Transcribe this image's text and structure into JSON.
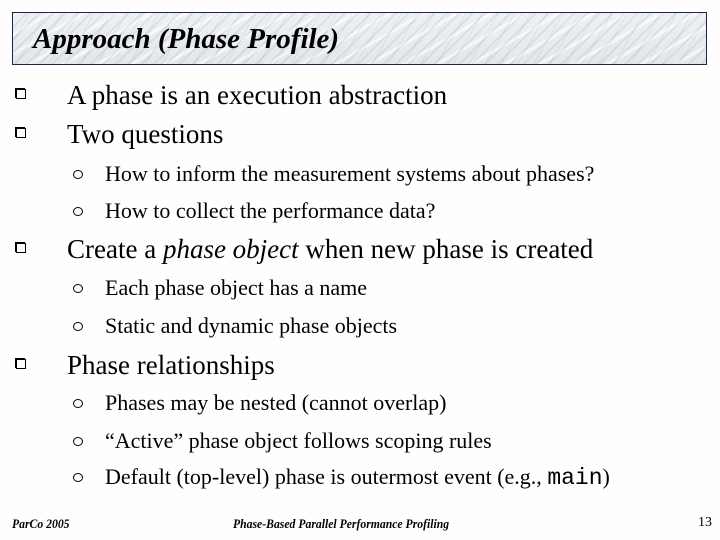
{
  "slide": {
    "title": "Approach (Phase Profile)",
    "bullets": [
      {
        "text": "A phase is an execution abstraction"
      },
      {
        "text": "Two questions",
        "sub": [
          "How to inform the measurement systems about phases?",
          "How to collect the performance data?"
        ]
      },
      {
        "text_before": "Create a ",
        "text_italic": "phase object",
        "text_after": " when new phase is created",
        "sub": [
          "Each phase object has a name",
          "Static and dynamic phase objects"
        ]
      },
      {
        "text": "Phase relationships",
        "sub": [
          "Phases may be nested (cannot overlap)",
          "“Active” phase object follows scoping rules"
        ],
        "sub_last": {
          "text_before": "Default (top-level) phase is outermost event (e.g., ",
          "code": "main",
          "text_after": ")"
        }
      }
    ],
    "bullet_icons": {
      "level1": "hollow-square-bullet",
      "level2": "hollow-circle-bullet"
    }
  },
  "footer": {
    "left": "ParCo 2005",
    "center": "Phase-Based Parallel Performance Profiling",
    "page_number": "13"
  }
}
